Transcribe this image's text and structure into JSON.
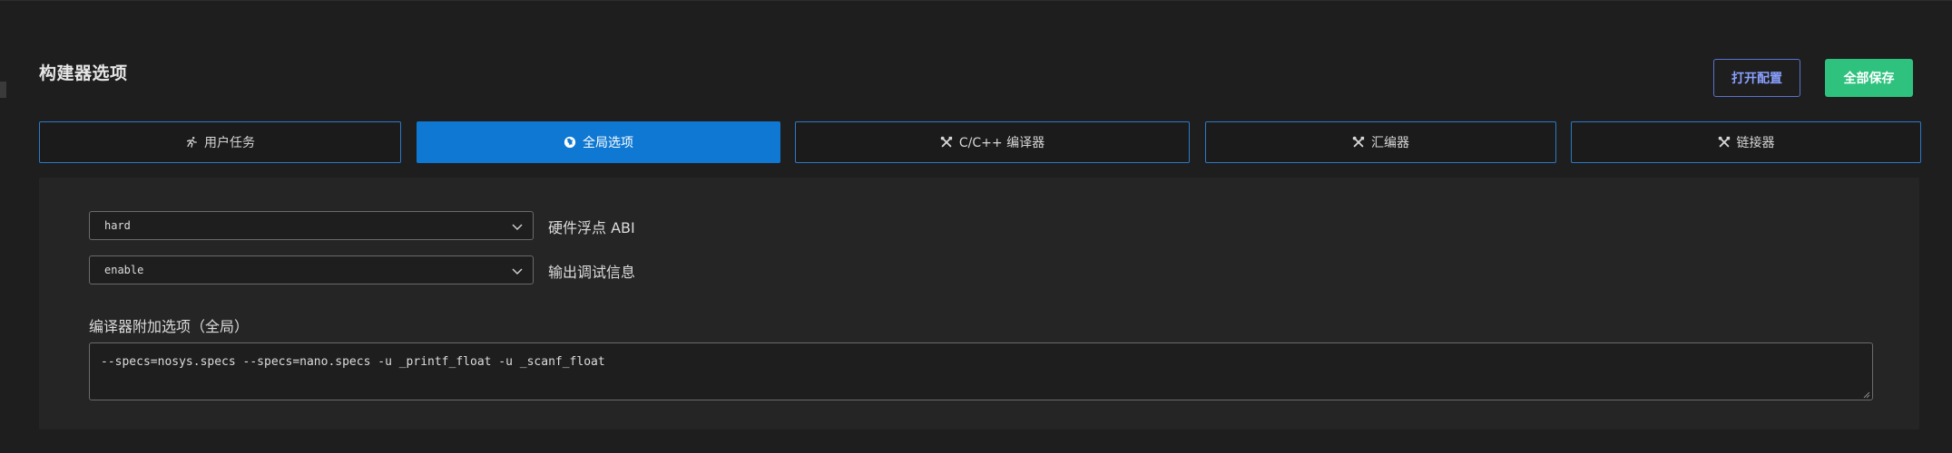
{
  "page": {
    "title": "构建器选项"
  },
  "header_buttons": {
    "open_config": "打开配置",
    "save_all": "全部保存"
  },
  "tabs": [
    {
      "label": "用户任务",
      "icon": "run-icon",
      "active": false
    },
    {
      "label": "全局选项",
      "icon": "globe-icon",
      "active": true
    },
    {
      "label": "C/C++ 编译器",
      "icon": "tools-icon",
      "active": false
    },
    {
      "label": "汇编器",
      "icon": "tools-icon",
      "active": false
    },
    {
      "label": "链接器",
      "icon": "tools-icon",
      "active": false
    }
  ],
  "options": {
    "float_abi": {
      "value": "hard",
      "label": "硬件浮点 ABI"
    },
    "debug_info": {
      "value": "enable",
      "label": "输出调试信息"
    }
  },
  "extra_options": {
    "label": "编译器附加选项（全局）",
    "value": "--specs=nosys.specs --specs=nano.specs -u _printf_float -u _scanf_float"
  },
  "colors": {
    "accent": "#0e78d3",
    "save_button": "#2ec27e",
    "open_button_border": "#5a73d1"
  }
}
